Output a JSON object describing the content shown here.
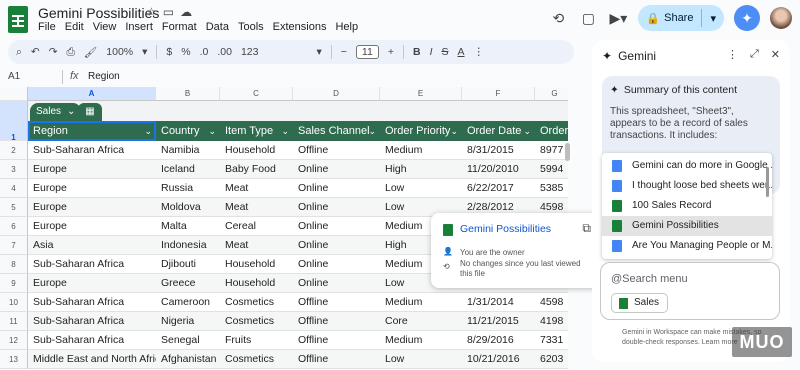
{
  "doc": {
    "title": "Gemini Possibilities"
  },
  "menu": [
    "File",
    "Edit",
    "View",
    "Insert",
    "Format",
    "Data",
    "Tools",
    "Extensions",
    "Help"
  ],
  "top": {
    "share_label": "Share"
  },
  "toolbar": {
    "zoom": "100%",
    "currency": "$",
    "percent": "%",
    "dec1": ".0",
    "dec2": ".00",
    "number": "123",
    "font_size": "11"
  },
  "formula_bar": {
    "cell_ref": "A1",
    "content": "Region"
  },
  "columns": [
    "A",
    "B",
    "C",
    "D",
    "E",
    "F",
    "G"
  ],
  "rows": [
    "1",
    "2",
    "3",
    "4",
    "5",
    "6",
    "7",
    "8",
    "9",
    "10",
    "11",
    "12",
    "13"
  ],
  "table": {
    "name": "Sales",
    "headers": [
      "Region",
      "Country",
      "Item Type",
      "Sales Channel",
      "Order Priority",
      "Order Date",
      "Order"
    ],
    "data": [
      [
        "Sub-Saharan Africa",
        "Namibia",
        "Household",
        "Offline",
        "Medium",
        "8/31/2015",
        "8977"
      ],
      [
        "Europe",
        "Iceland",
        "Baby Food",
        "Online",
        "High",
        "11/20/2010",
        "5994"
      ],
      [
        "Europe",
        "Russia",
        "Meat",
        "Online",
        "Low",
        "6/22/2017",
        "5385"
      ],
      [
        "Europe",
        "Moldova",
        "Meat",
        "Online",
        "Low",
        "2/28/2012",
        "4598"
      ],
      [
        "Europe",
        "Malta",
        "Cereal",
        "Online",
        "Medium",
        "",
        ""
      ],
      [
        "Asia",
        "Indonesia",
        "Meat",
        "Online",
        "High",
        "",
        ""
      ],
      [
        "Sub-Saharan Africa",
        "Djibouti",
        "Household",
        "Online",
        "Medium",
        "",
        ""
      ],
      [
        "Europe",
        "Greece",
        "Household",
        "Online",
        "Low",
        "",
        ""
      ],
      [
        "Sub-Saharan Africa",
        "Cameroon",
        "Cosmetics",
        "Offline",
        "Medium",
        "1/31/2014",
        "4598"
      ],
      [
        "Sub-Saharan Africa",
        "Nigeria",
        "Cosmetics",
        "Offline",
        "Core",
        "11/21/2015",
        "4198"
      ],
      [
        "Sub-Saharan Africa",
        "Senegal",
        "Fruits",
        "Offline",
        "Medium",
        "8/29/2016",
        "7331"
      ],
      [
        "Middle East and North Africa",
        "Afghanistan",
        "Cosmetics",
        "Offline",
        "Low",
        "10/21/2016",
        "6203"
      ]
    ]
  },
  "hover_card": {
    "title": "Gemini Possibilities",
    "owner": "You are the owner",
    "changes": "No changes since you last viewed this file"
  },
  "gemini": {
    "title": "Gemini",
    "summary_title": "Summary of this content",
    "summary_text": "This spreadsheet, \"Sheet3\", appears to be a record of sales transactions. It includes:",
    "files": [
      {
        "name": "Gemini can do more in Google ...",
        "type": "doc"
      },
      {
        "name": "I thought loose bed sheets wer...",
        "type": "doc"
      },
      {
        "name": "100 Sales Record",
        "type": "sheet"
      },
      {
        "name": "Gemini Possibilities",
        "type": "sheet"
      },
      {
        "name": "Are You Managing People or M...",
        "type": "doc"
      }
    ],
    "input_placeholder": "@Search menu",
    "chip": "Sales",
    "disclaimer": "Gemini in Workspace can make mistakes, so double-check responses. Learn more"
  },
  "watermark": "MUO",
  "colors": {
    "table_header": "#2e6b4f",
    "accent": "#1a73e8",
    "share_bg": "#c2e7ff"
  }
}
